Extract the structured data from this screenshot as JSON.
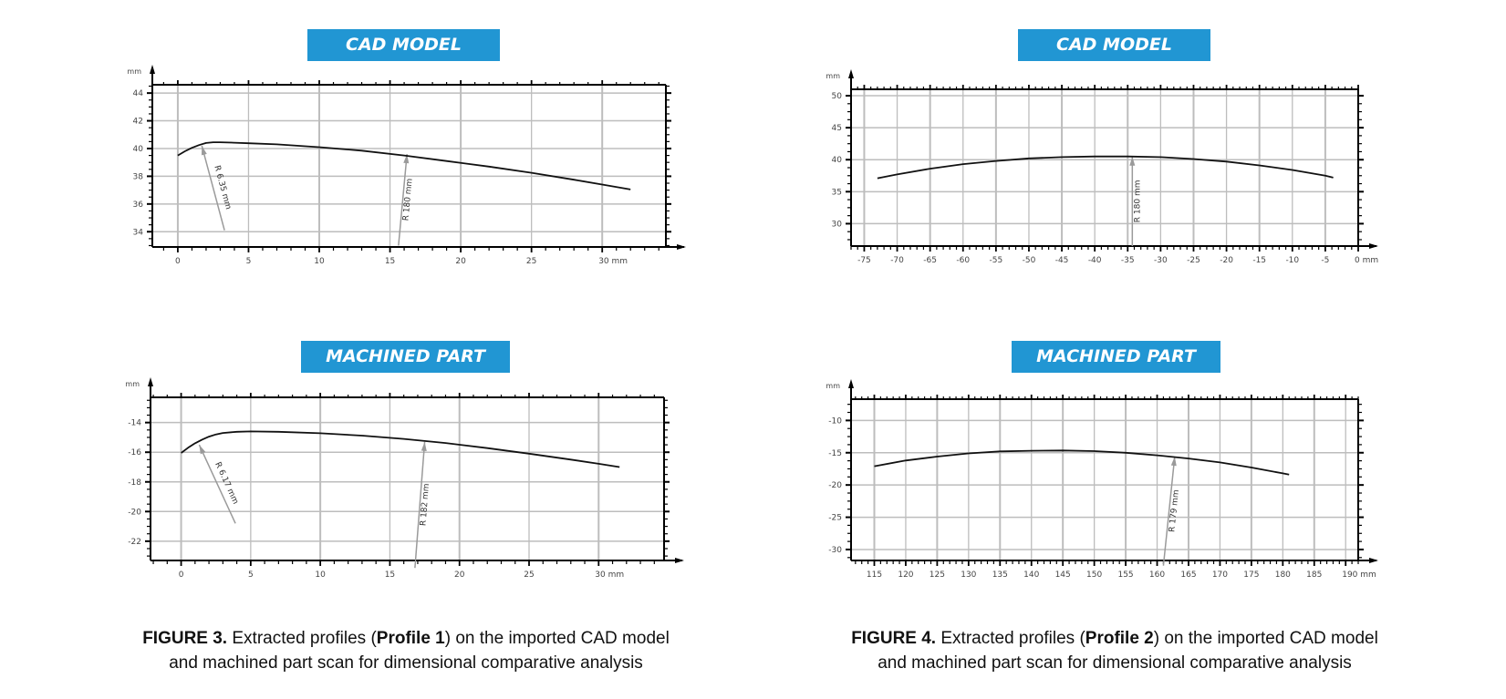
{
  "figures": [
    {
      "caption_label": "FIGURE 3.",
      "caption_pre": " Extracted profiles (",
      "caption_bold": "Profile 1",
      "caption_post": ") on the imported CAD model",
      "caption_line2": "and machined part scan for dimensional comparative analysis"
    },
    {
      "caption_label": "FIGURE 4.",
      "caption_pre": " Extracted profiles (",
      "caption_bold": "Profile 2",
      "caption_post": ") on the imported CAD model",
      "caption_line2": "and machined part scan for dimensional comparative analysis"
    }
  ],
  "colors": {
    "title_bg": "#2196d3",
    "grid": "#bdbdbd",
    "curve": "#111111",
    "annotation": "#9a9a9a"
  },
  "chart_data": [
    {
      "type": "line",
      "title": "CAD MODEL",
      "profile": "Profile 1",
      "ylabel": "mm",
      "xlabel": "mm",
      "xlim": [
        -1.8,
        34.5
      ],
      "ylim": [
        32.9,
        44.6
      ],
      "xticks": [
        0,
        5,
        10,
        15,
        20,
        25,
        30
      ],
      "xtick_labels": [
        "0",
        "5",
        "10",
        "15",
        "20",
        "25",
        "30 mm"
      ],
      "yticks": [
        34,
        36,
        38,
        40,
        42,
        44
      ],
      "grid": true,
      "series": [
        {
          "name": "profile",
          "x": [
            0,
            0.5,
            1,
            1.5,
            2,
            2.5,
            3,
            4,
            5,
            7,
            10,
            13,
            16,
            19,
            22,
            25,
            28,
            30,
            32
          ],
          "y": [
            39.5,
            39.8,
            40.05,
            40.25,
            40.4,
            40.45,
            40.45,
            40.42,
            40.38,
            40.3,
            40.1,
            39.85,
            39.5,
            39.1,
            38.7,
            38.25,
            37.75,
            37.4,
            37.05
          ]
        }
      ],
      "annotations": [
        {
          "text": "R 6.35 mm",
          "from": [
            3.3,
            34.1
          ],
          "to": [
            1.7,
            40.2
          ]
        },
        {
          "text": "R 180 mm",
          "from": [
            15.6,
            33.0
          ],
          "to": [
            16.2,
            39.6
          ]
        }
      ]
    },
    {
      "type": "line",
      "title": "CAD MODEL",
      "profile": "Profile 2",
      "ylabel": "mm",
      "xlabel": "mm",
      "xlim": [
        -77,
        0
      ],
      "ylim": [
        26.5,
        51
      ],
      "xticks": [
        -75,
        -70,
        -65,
        -60,
        -55,
        -50,
        -45,
        -40,
        -35,
        -30,
        -25,
        -20,
        -15,
        -10,
        -5,
        0
      ],
      "xtick_labels": [
        "-75",
        "-70",
        "-65",
        "-60",
        "-55",
        "-50",
        "-45",
        "-40",
        "-35",
        "-30",
        "-25",
        "-20",
        "-15",
        "-10",
        "-5",
        "0 mm"
      ],
      "yticks": [
        30,
        35,
        40,
        45,
        50
      ],
      "grid": true,
      "series": [
        {
          "name": "profile",
          "x": [
            -73,
            -70,
            -65,
            -60,
            -55,
            -50,
            -45,
            -40,
            -35,
            -30,
            -25,
            -20,
            -15,
            -10,
            -5,
            -3.8
          ],
          "y": [
            37.1,
            37.7,
            38.6,
            39.3,
            39.8,
            40.2,
            40.4,
            40.5,
            40.5,
            40.4,
            40.1,
            39.7,
            39.1,
            38.4,
            37.5,
            37.2
          ]
        }
      ],
      "annotations": [
        {
          "text": "R 180 mm",
          "from": [
            -34.3,
            26.5
          ],
          "to": [
            -34.3,
            40.5
          ]
        }
      ]
    },
    {
      "type": "line",
      "title": "MACHINED PART",
      "profile": "Profile 1",
      "ylabel": "mm",
      "xlabel": "mm",
      "xlim": [
        -2.2,
        34.7
      ],
      "ylim": [
        -23.3,
        -12.3
      ],
      "xticks": [
        0,
        5,
        10,
        15,
        20,
        25,
        30
      ],
      "xtick_labels": [
        "0",
        "5",
        "10",
        "15",
        "20",
        "25",
        "30 mm"
      ],
      "yticks": [
        -22,
        -20,
        -18,
        -16,
        -14
      ],
      "grid": true,
      "series": [
        {
          "name": "profile",
          "x": [
            0,
            0.5,
            1,
            1.5,
            2,
            2.5,
            3,
            4,
            5,
            7,
            10,
            13,
            16,
            19,
            22,
            25,
            28,
            30,
            31.5
          ],
          "y": [
            -16.05,
            -15.7,
            -15.4,
            -15.15,
            -14.95,
            -14.8,
            -14.7,
            -14.62,
            -14.6,
            -14.62,
            -14.72,
            -14.88,
            -15.1,
            -15.38,
            -15.72,
            -16.1,
            -16.5,
            -16.78,
            -17.0
          ]
        }
      ],
      "annotations": [
        {
          "text": "R 6.17 mm",
          "from": [
            3.9,
            -20.8
          ],
          "to": [
            1.3,
            -15.5
          ]
        },
        {
          "text": "R 182 mm",
          "from": [
            16.8,
            -23.8
          ],
          "to": [
            17.5,
            -15.3
          ]
        }
      ]
    },
    {
      "type": "line",
      "title": "MACHINED PART",
      "profile": "Profile 2",
      "ylabel": "mm",
      "xlabel": "mm",
      "xlim": [
        111.3,
        192
      ],
      "ylim": [
        -31.7,
        -6.7
      ],
      "xticks": [
        115,
        120,
        125,
        130,
        135,
        140,
        145,
        150,
        155,
        160,
        165,
        170,
        175,
        180,
        185,
        190
      ],
      "xtick_labels": [
        "115",
        "120",
        "125",
        "130",
        "135",
        "140",
        "145",
        "150",
        "155",
        "160",
        "165",
        "170",
        "175",
        "180",
        "185",
        "190 mm"
      ],
      "yticks": [
        -30,
        -25,
        -20,
        -15,
        -10
      ],
      "grid": true,
      "series": [
        {
          "name": "profile",
          "x": [
            115,
            120,
            125,
            130,
            135,
            140,
            145,
            150,
            155,
            160,
            165,
            170,
            175,
            180,
            181
          ],
          "y": [
            -17.1,
            -16.2,
            -15.6,
            -15.1,
            -14.8,
            -14.7,
            -14.65,
            -14.75,
            -15.0,
            -15.4,
            -15.9,
            -16.5,
            -17.3,
            -18.2,
            -18.4
          ]
        }
      ],
      "annotations": [
        {
          "text": "R 179 mm",
          "from": [
            161,
            -32.5
          ],
          "to": [
            162.8,
            -15.6
          ]
        }
      ]
    }
  ]
}
